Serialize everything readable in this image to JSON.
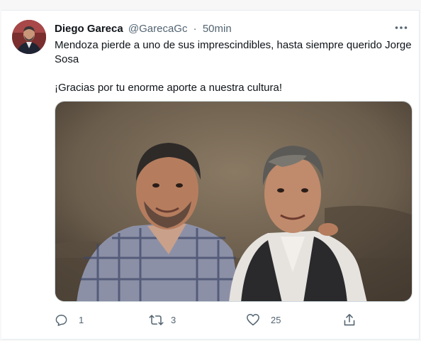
{
  "tweet": {
    "author_name": "Diego Gareca",
    "handle": "@GarecaGc",
    "separator": "·",
    "time": "50min",
    "text_line1": "Mendoza pierde a uno de sus imprescindibles, hasta siempre querido Jorge Sosa",
    "text_line2": "¡Gracias por tu enorme aporte a nuestra cultura!"
  },
  "actions": {
    "reply_icon": "comment-icon",
    "reply_count": "1",
    "retweet_icon": "retweet-icon",
    "retweet_count": "3",
    "like_icon": "heart-icon",
    "like_count": "25",
    "share_icon": "share-icon"
  },
  "colors": {
    "text": "#0f1419",
    "secondary": "#536471",
    "border": "#e6ecf0"
  }
}
